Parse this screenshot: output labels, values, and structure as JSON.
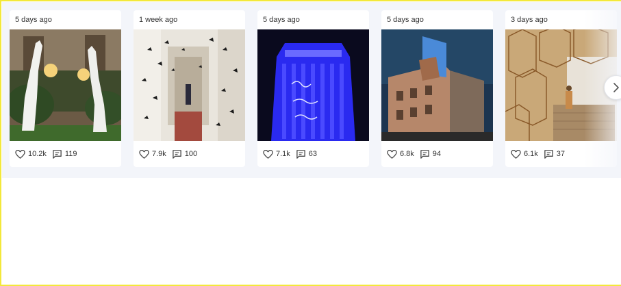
{
  "feed": {
    "posts": [
      {
        "time": "5 days ago",
        "likes": "10.2k",
        "comments": "119",
        "image": "giraffe-lamps-courtyard"
      },
      {
        "time": "1 week ago",
        "likes": "7.9k",
        "comments": "100",
        "image": "butterfly-hallway"
      },
      {
        "time": "5 days ago",
        "likes": "7.1k",
        "comments": "63",
        "image": "blue-lit-tower"
      },
      {
        "time": "5 days ago",
        "likes": "6.8k",
        "comments": "94",
        "image": "building-night-installation"
      },
      {
        "time": "3 days ago",
        "likes": "6.1k",
        "comments": "37",
        "image": "wooden-lattice-installation"
      }
    ],
    "icons": {
      "like": "heart-icon",
      "comment": "comment-icon",
      "next": "chevron-right-icon"
    }
  },
  "colors": {
    "frame_border": "#f3e83a",
    "strip_bg": "#f3f5fa",
    "card_bg": "#ffffff",
    "text": "#333333"
  }
}
